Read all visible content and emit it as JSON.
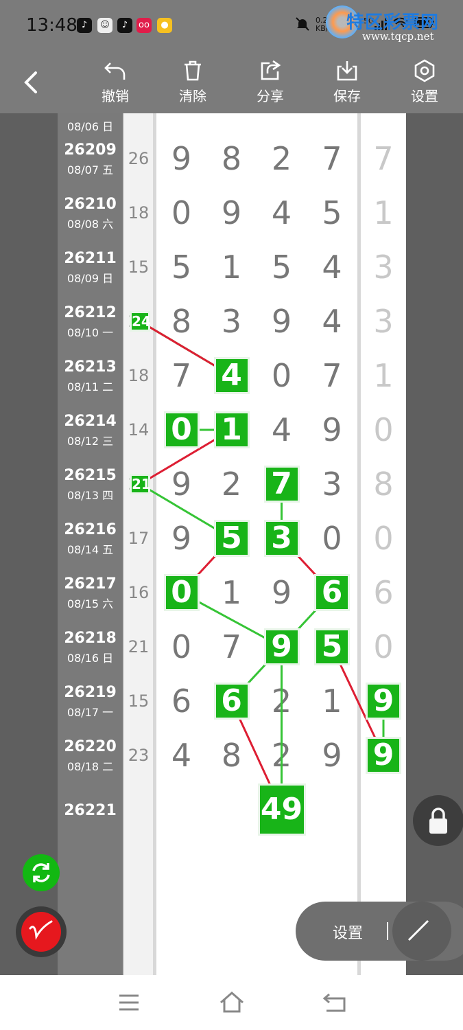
{
  "status": {
    "time": "13:48",
    "apps": [
      "♪",
      "☺",
      "♪",
      "oo",
      "●"
    ],
    "net_speed": "0.21 KB/s",
    "signal": "5G"
  },
  "watermark": {
    "title": "特区彩票网",
    "url": "www.tqcp.net"
  },
  "toolbar": {
    "undo": "撤销",
    "clear": "清除",
    "share": "分享",
    "save": "保存",
    "settings": "设置"
  },
  "rows": [
    {
      "issue": "",
      "date": "08/06 日",
      "sum": "",
      "digits": [
        "",
        "",
        "",
        "",
        ""
      ],
      "partial": true
    },
    {
      "issue": "26209",
      "date": "08/07 五",
      "sum": "26",
      "digits": [
        "9",
        "8",
        "2",
        "7",
        "7"
      ]
    },
    {
      "issue": "26210",
      "date": "08/08 六",
      "sum": "18",
      "digits": [
        "0",
        "9",
        "4",
        "5",
        "1"
      ]
    },
    {
      "issue": "26211",
      "date": "08/09 日",
      "sum": "15",
      "digits": [
        "5",
        "1",
        "5",
        "4",
        "3"
      ]
    },
    {
      "issue": "26212",
      "date": "08/10 一",
      "sum": "24",
      "digits": [
        "8",
        "3",
        "9",
        "4",
        "3"
      ]
    },
    {
      "issue": "26213",
      "date": "08/11 二",
      "sum": "18",
      "digits": [
        "7",
        "4",
        "0",
        "7",
        "1"
      ]
    },
    {
      "issue": "26214",
      "date": "08/12 三",
      "sum": "14",
      "digits": [
        "0",
        "1",
        "4",
        "9",
        "0"
      ]
    },
    {
      "issue": "26215",
      "date": "08/13 四",
      "sum": "21",
      "digits": [
        "9",
        "2",
        "7",
        "3",
        "8"
      ]
    },
    {
      "issue": "26216",
      "date": "08/14 五",
      "sum": "17",
      "digits": [
        "9",
        "5",
        "3",
        "0",
        "0"
      ]
    },
    {
      "issue": "26217",
      "date": "08/15 六",
      "sum": "16",
      "digits": [
        "0",
        "1",
        "9",
        "6",
        "6"
      ]
    },
    {
      "issue": "26218",
      "date": "08/16 日",
      "sum": "21",
      "digits": [
        "0",
        "7",
        "9",
        "5",
        "0"
      ]
    },
    {
      "issue": "26219",
      "date": "08/17 一",
      "sum": "15",
      "digits": [
        "6",
        "6",
        "2",
        "1",
        "9"
      ]
    },
    {
      "issue": "26220",
      "date": "08/18 二",
      "sum": "23",
      "digits": [
        "4",
        "8",
        "2",
        "9",
        "9"
      ]
    },
    {
      "issue": "26221",
      "date": "",
      "sum": "",
      "digits": [
        "",
        "",
        "",
        "",
        ""
      ]
    },
    {
      "issue": "",
      "date": "",
      "sum": "",
      "digits": [
        "",
        "",
        "",
        "",
        ""
      ]
    },
    {
      "issue": "",
      "date": "",
      "sum": "",
      "digits": [
        "",
        "",
        "",
        "",
        ""
      ]
    },
    {
      "issue": "",
      "date": "",
      "sum": "",
      "digits": [
        "",
        "",
        "",
        "",
        ""
      ]
    }
  ],
  "highlights": [
    {
      "row": 4,
      "col": "sum",
      "value": "24"
    },
    {
      "row": 5,
      "col": 1,
      "value": "4"
    },
    {
      "row": 6,
      "col": 0,
      "value": "0"
    },
    {
      "row": 6,
      "col": 1,
      "value": "1"
    },
    {
      "row": 7,
      "col": "sum",
      "value": "21"
    },
    {
      "row": 7,
      "col": 2,
      "value": "7"
    },
    {
      "row": 8,
      "col": 1,
      "value": "5"
    },
    {
      "row": 8,
      "col": 2,
      "value": "3"
    },
    {
      "row": 9,
      "col": 0,
      "value": "0"
    },
    {
      "row": 9,
      "col": 3,
      "value": "6"
    },
    {
      "row": 10,
      "col": 2,
      "value": "9"
    },
    {
      "row": 10,
      "col": 3,
      "value": "5"
    },
    {
      "row": 11,
      "col": 1,
      "value": "6"
    },
    {
      "row": 11,
      "col": 4,
      "value": "9"
    },
    {
      "row": 12,
      "col": 4,
      "value": "9"
    },
    {
      "row": 13,
      "col": 2,
      "value": "49"
    }
  ],
  "connections": {
    "green": [
      [
        0,
        1
      ],
      [
        2,
        3
      ],
      [
        4,
        6
      ],
      [
        5,
        7
      ],
      [
        8,
        10
      ],
      [
        9,
        12
      ],
      [
        10,
        15
      ],
      [
        13,
        14
      ]
    ],
    "red": [
      [
        0,
        1
      ],
      [
        3,
        4
      ],
      [
        6,
        8
      ],
      [
        7,
        9
      ],
      [
        11,
        14
      ],
      [
        12,
        15
      ]
    ]
  },
  "colors": {
    "highlight": "#18b418",
    "red_line": "#dd1e33",
    "green_line": "#36c436"
  },
  "floating": {
    "settings_label": "设置",
    "sync_icon": "sync-icon",
    "pen_icon": "pen-icon",
    "lock_icon": "lock-icon"
  }
}
